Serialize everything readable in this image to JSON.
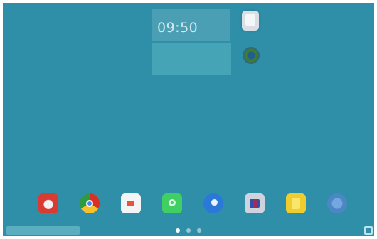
{
  "clock_widget": {
    "time": "09:50",
    "date": "",
    "location": ""
  },
  "search_widget": {
    "label": ""
  },
  "home_apps": [
    {
      "name": "app-shortcut-1-icon"
    },
    {
      "name": "app-shortcut-2-icon"
    }
  ],
  "dock": [
    {
      "name": "red-app-icon"
    },
    {
      "name": "chrome-icon"
    },
    {
      "name": "play-store-icon"
    },
    {
      "name": "phone-icon"
    },
    {
      "name": "globe-browser-icon"
    },
    {
      "name": "gallery-icon"
    },
    {
      "name": "notes-icon"
    },
    {
      "name": "settings-icon"
    }
  ],
  "navigation": {
    "page_count": 3,
    "active_page": 1
  },
  "colors": {
    "wallpaper": "#2f8ea8",
    "widget": "#4a9fb4",
    "accent": "#5fb1c1"
  }
}
